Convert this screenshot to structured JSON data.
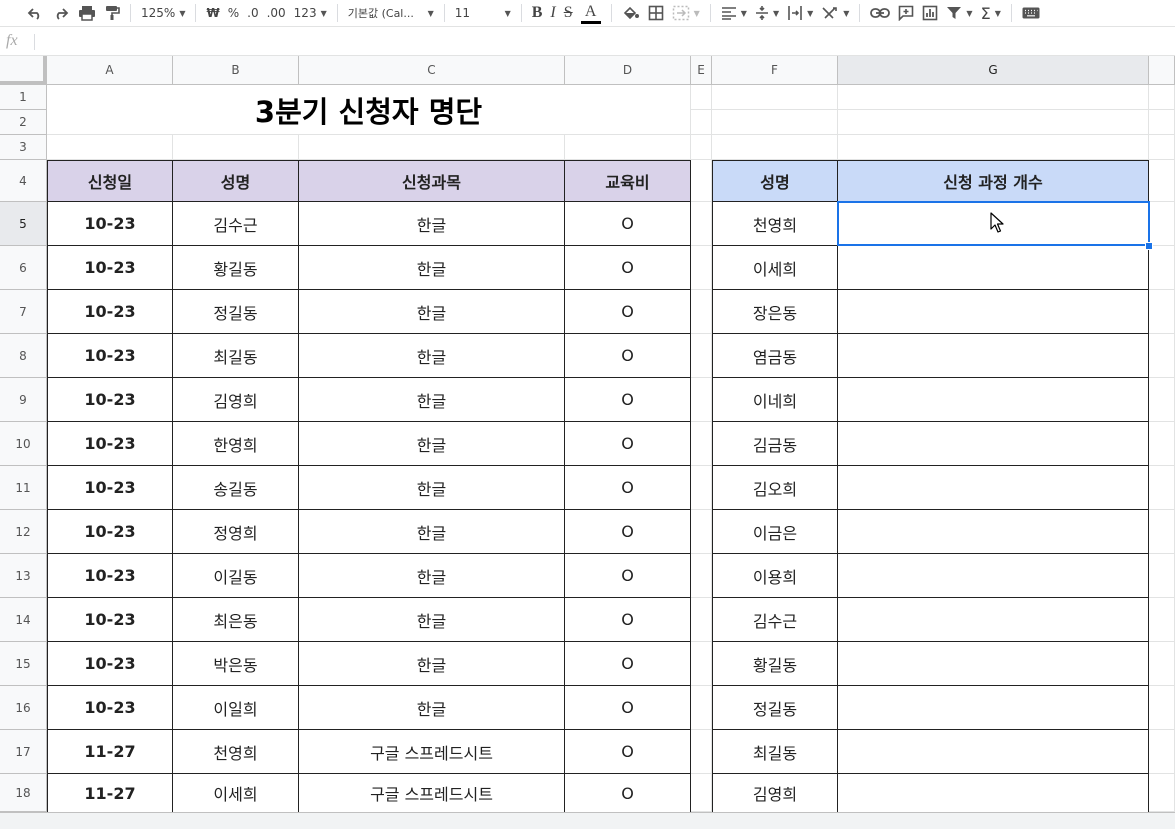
{
  "toolbar": {
    "zoom": "125%",
    "currency": "₩",
    "percent": "%",
    "decimal_decrease": ".0",
    "decimal_increase": ".00",
    "number_format": "123",
    "font_family": "기본값 (Cal...",
    "font_size": "11",
    "bold": "B",
    "italic": "I",
    "strike": "S",
    "text_color": "A",
    "sum": "Σ"
  },
  "formula_bar": {
    "label": "fx",
    "value": ""
  },
  "columns": [
    "A",
    "B",
    "C",
    "D",
    "E",
    "F",
    "G"
  ],
  "rows": [
    "1",
    "2",
    "3",
    "4",
    "5",
    "6",
    "7",
    "8",
    "9",
    "10",
    "11",
    "12",
    "13",
    "14",
    "15",
    "16",
    "17",
    "18"
  ],
  "title": "3분기 신청자 명단",
  "table1": {
    "headers": [
      "신청일",
      "성명",
      "신청과목",
      "교육비"
    ],
    "rows": [
      [
        "10-23",
        "김수근",
        "한글",
        "O"
      ],
      [
        "10-23",
        "황길동",
        "한글",
        "O"
      ],
      [
        "10-23",
        "정길동",
        "한글",
        "O"
      ],
      [
        "10-23",
        "최길동",
        "한글",
        "O"
      ],
      [
        "10-23",
        "김영희",
        "한글",
        "O"
      ],
      [
        "10-23",
        "한영희",
        "한글",
        "O"
      ],
      [
        "10-23",
        "송길동",
        "한글",
        "O"
      ],
      [
        "10-23",
        "정영희",
        "한글",
        "O"
      ],
      [
        "10-23",
        "이길동",
        "한글",
        "O"
      ],
      [
        "10-23",
        "최은동",
        "한글",
        "O"
      ],
      [
        "10-23",
        "박은동",
        "한글",
        "O"
      ],
      [
        "10-23",
        "이일희",
        "한글",
        "O"
      ],
      [
        "11-27",
        "천영희",
        "구글 스프레드시트",
        "O"
      ],
      [
        "11-27",
        "이세희",
        "구글 스프레드시트",
        "O"
      ]
    ]
  },
  "table2": {
    "headers": [
      "성명",
      "신청 과정 개수"
    ],
    "names": [
      "천영희",
      "이세희",
      "장은동",
      "염금동",
      "이네희",
      "김금동",
      "김오희",
      "이금은",
      "이용희",
      "김수근",
      "황길동",
      "정길동",
      "최길동",
      "김영희"
    ]
  },
  "colors": {
    "header_purple": "#d9d2e9",
    "header_blue": "#c9daf8",
    "selection": "#1a73e8"
  }
}
